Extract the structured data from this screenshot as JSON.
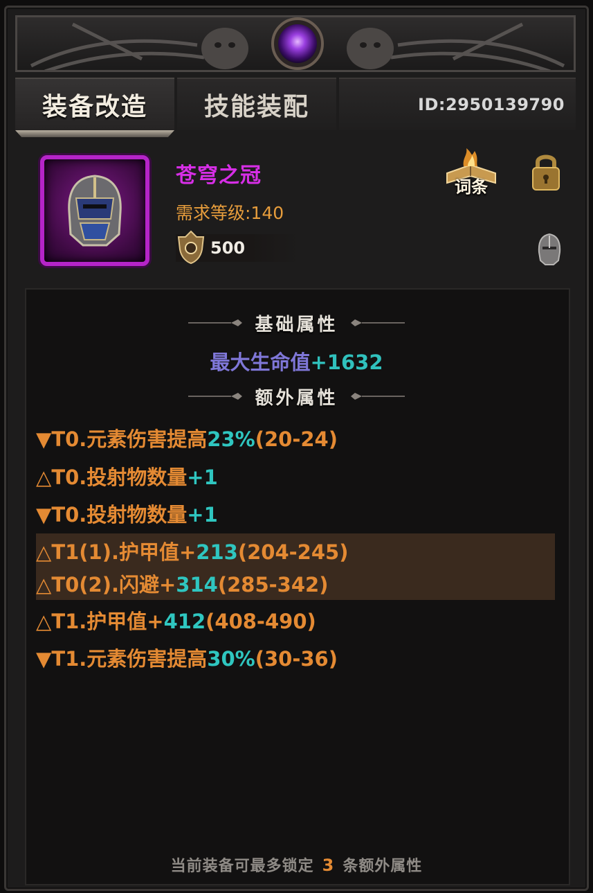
{
  "tabs": {
    "active": "装备改造",
    "inactive": "技能装配"
  },
  "player_id": "ID:2950139790",
  "item": {
    "name": "苍穹之冠",
    "level_req": "需求等级:140",
    "power": "500",
    "icon": "purple-helmet-icon",
    "rarity_color": "#b524c8"
  },
  "buttons": {
    "affix_label": "词条",
    "lock_icon": "padlock-icon"
  },
  "sections": {
    "base_title": "基础属性",
    "extra_title": "额外属性"
  },
  "base_stat": {
    "name": "最大生命值",
    "value": "+1632"
  },
  "affixes": [
    {
      "marker": "▼",
      "text": "T0.元素伤害提高",
      "value": "23%",
      "range": "(20-24)",
      "locked": false
    },
    {
      "marker": "△",
      "text": "T0.投射物数量",
      "value": "+1",
      "range": "",
      "locked": false
    },
    {
      "marker": "▼",
      "text": "T0.投射物数量",
      "value": "+1",
      "range": "",
      "locked": false
    },
    {
      "marker": "△",
      "text": "T1(1).护甲值+",
      "value": "213",
      "range": "(204-245)",
      "locked": true
    },
    {
      "marker": "△",
      "text": "T0(2).闪避+",
      "value": "314",
      "range": "(285-342)",
      "locked": true
    },
    {
      "marker": "△",
      "text": "T1.护甲值+",
      "value": "412",
      "range": "(408-490)",
      "locked": false
    },
    {
      "marker": "▼",
      "text": "T1.元素伤害提高",
      "value": "30%",
      "range": "(30-36)",
      "locked": false
    }
  ],
  "footer": {
    "before": "当前装备可最多锁定",
    "count": "3",
    "after": "条额外属性"
  },
  "colors": {
    "affix_orange": "#e48a33",
    "value_cyan": "#2fc6c0",
    "base_name_purple": "#7f77d8",
    "item_name_magenta": "#d62ee6"
  }
}
